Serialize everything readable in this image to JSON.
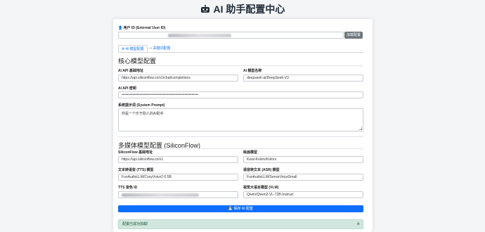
{
  "page": {
    "title": "AI 助手配置中心"
  },
  "user": {
    "label": "用户 ID (External User ID)",
    "load_button": "加载配置"
  },
  "tabs": [
    {
      "label": "AI 模型配置"
    },
    {
      "label": "关键词配置"
    }
  ],
  "core_section": {
    "heading": "核心模型配置",
    "api_url_label": "AI API 基础地址",
    "api_url_value": "https://api.siliconflow.cn/v1/chat/completions",
    "model_label": "AI 模型名称",
    "model_value": "deepseek-ai/DeepSeek-V3",
    "api_key_label": "AI API 密钥",
    "api_key_value": "••••••••••••••••••••••••••••••••••••••••••••••••••••••••",
    "prompt_label": "系统提示词 (System Prompt)",
    "prompt_value": "你是一个乐于助人的AI助手"
  },
  "media_section": {
    "heading": "多媒体模型配置 (SiliconFlow)",
    "base_url_label": "SiliconFlow 基础地址",
    "base_url_value": "https://api.siliconflow.cn/v1",
    "image_model_label": "绘画模型",
    "image_model_value": "Kwai-Kolors/Kolors",
    "tts_label": "文本转语音 (TTS) 模型",
    "tts_value": "FunAudioLLM/CosyVoice2-0.5B",
    "asr_label": "语音转文本 (ASR) 模型",
    "asr_value": "FunAudioLLM/SenseVoiceSmall",
    "voice_id_label": "TTS 音色 ID",
    "vlm_label": "视觉大语言模型 (VLM)",
    "vlm_value": "Qwen/Qwen2-VL-72B-Instruct"
  },
  "save_button": "保存 AI 配置",
  "alert": {
    "message": "配置已成功加载!",
    "close": "×"
  },
  "colors": {
    "primary": "#0d6efd",
    "secondary_button": "#6c757d",
    "success_bg": "#d1e7dd",
    "success_text": "#0f5132"
  },
  "icons": [
    "robot-icon",
    "user-lock-icon",
    "gear-icon",
    "key-icon",
    "save-icon",
    "close-icon"
  ]
}
